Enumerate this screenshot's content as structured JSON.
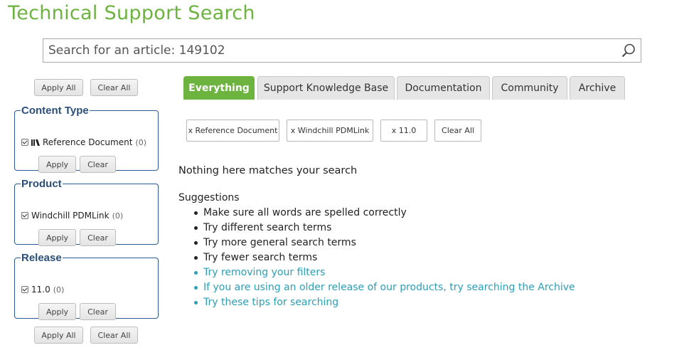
{
  "page_title": "Technical Support Search",
  "search": {
    "value": "Search for an article: 149102",
    "placeholder": "Search for an article: 149102"
  },
  "sidebar": {
    "apply_all_label": "Apply All",
    "clear_all_label": "Clear All",
    "facets": [
      {
        "legend": "Content Type",
        "items": [
          {
            "label": "Reference Document",
            "count": "(0)",
            "checked": true,
            "icon": "document-icon"
          }
        ],
        "apply_label": "Apply",
        "clear_label": "Clear"
      },
      {
        "legend": "Product",
        "items": [
          {
            "label": "Windchill PDMLink",
            "count": "(0)",
            "checked": true
          }
        ],
        "apply_label": "Apply",
        "clear_label": "Clear"
      },
      {
        "legend": "Release",
        "items": [
          {
            "label": "11.0",
            "count": "(0)",
            "checked": true
          }
        ],
        "apply_label": "Apply",
        "clear_label": "Clear"
      }
    ]
  },
  "tabs": [
    {
      "label": "Everything",
      "active": true
    },
    {
      "label": "Support Knowledge Base",
      "active": false
    },
    {
      "label": "Documentation",
      "active": false
    },
    {
      "label": "Community",
      "active": false
    },
    {
      "label": "Archive",
      "active": false
    }
  ],
  "filter_chips": [
    "x Reference Document",
    "x Windchill PDMLink",
    "x 11.0",
    "Clear All"
  ],
  "results": {
    "no_results_text": "Nothing here matches your search",
    "suggestions_title": "Suggestions",
    "suggestions": [
      {
        "text": "Make sure all words are spelled correctly",
        "link": false
      },
      {
        "text": "Try different search terms",
        "link": false
      },
      {
        "text": "Try more general search terms",
        "link": false
      },
      {
        "text": "Try fewer search terms",
        "link": false
      },
      {
        "text": "Try removing your filters",
        "link": true
      },
      {
        "text": "If you are using an older release of our products, try searching the Archive",
        "link": true
      },
      {
        "text": "Try these tips for searching",
        "link": true
      }
    ]
  },
  "colors": {
    "brand_green": "#6cb33f",
    "facet_border": "#2b5b94",
    "link": "#2aa0b8"
  }
}
